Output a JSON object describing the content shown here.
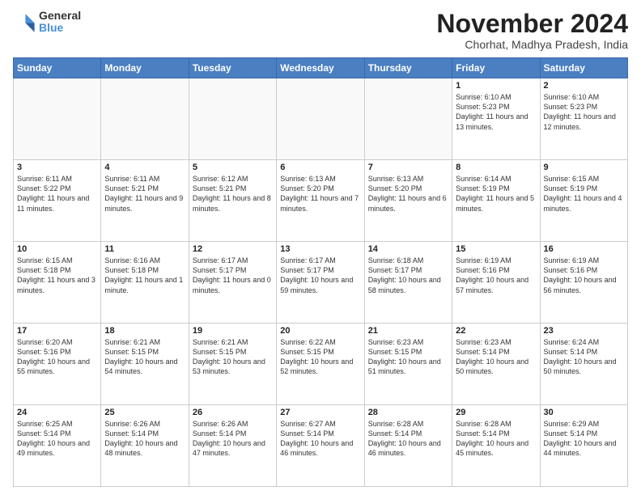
{
  "logo": {
    "general": "General",
    "blue": "Blue"
  },
  "header": {
    "month": "November 2024",
    "location": "Chorhat, Madhya Pradesh, India"
  },
  "weekdays": [
    "Sunday",
    "Monday",
    "Tuesday",
    "Wednesday",
    "Thursday",
    "Friday",
    "Saturday"
  ],
  "weeks": [
    [
      {
        "day": "",
        "info": ""
      },
      {
        "day": "",
        "info": ""
      },
      {
        "day": "",
        "info": ""
      },
      {
        "day": "",
        "info": ""
      },
      {
        "day": "",
        "info": ""
      },
      {
        "day": "1",
        "info": "Sunrise: 6:10 AM\nSunset: 5:23 PM\nDaylight: 11 hours and 13 minutes."
      },
      {
        "day": "2",
        "info": "Sunrise: 6:10 AM\nSunset: 5:23 PM\nDaylight: 11 hours and 12 minutes."
      }
    ],
    [
      {
        "day": "3",
        "info": "Sunrise: 6:11 AM\nSunset: 5:22 PM\nDaylight: 11 hours and 11 minutes."
      },
      {
        "day": "4",
        "info": "Sunrise: 6:11 AM\nSunset: 5:21 PM\nDaylight: 11 hours and 9 minutes."
      },
      {
        "day": "5",
        "info": "Sunrise: 6:12 AM\nSunset: 5:21 PM\nDaylight: 11 hours and 8 minutes."
      },
      {
        "day": "6",
        "info": "Sunrise: 6:13 AM\nSunset: 5:20 PM\nDaylight: 11 hours and 7 minutes."
      },
      {
        "day": "7",
        "info": "Sunrise: 6:13 AM\nSunset: 5:20 PM\nDaylight: 11 hours and 6 minutes."
      },
      {
        "day": "8",
        "info": "Sunrise: 6:14 AM\nSunset: 5:19 PM\nDaylight: 11 hours and 5 minutes."
      },
      {
        "day": "9",
        "info": "Sunrise: 6:15 AM\nSunset: 5:19 PM\nDaylight: 11 hours and 4 minutes."
      }
    ],
    [
      {
        "day": "10",
        "info": "Sunrise: 6:15 AM\nSunset: 5:18 PM\nDaylight: 11 hours and 3 minutes."
      },
      {
        "day": "11",
        "info": "Sunrise: 6:16 AM\nSunset: 5:18 PM\nDaylight: 11 hours and 1 minute."
      },
      {
        "day": "12",
        "info": "Sunrise: 6:17 AM\nSunset: 5:17 PM\nDaylight: 11 hours and 0 minutes."
      },
      {
        "day": "13",
        "info": "Sunrise: 6:17 AM\nSunset: 5:17 PM\nDaylight: 10 hours and 59 minutes."
      },
      {
        "day": "14",
        "info": "Sunrise: 6:18 AM\nSunset: 5:17 PM\nDaylight: 10 hours and 58 minutes."
      },
      {
        "day": "15",
        "info": "Sunrise: 6:19 AM\nSunset: 5:16 PM\nDaylight: 10 hours and 57 minutes."
      },
      {
        "day": "16",
        "info": "Sunrise: 6:19 AM\nSunset: 5:16 PM\nDaylight: 10 hours and 56 minutes."
      }
    ],
    [
      {
        "day": "17",
        "info": "Sunrise: 6:20 AM\nSunset: 5:16 PM\nDaylight: 10 hours and 55 minutes."
      },
      {
        "day": "18",
        "info": "Sunrise: 6:21 AM\nSunset: 5:15 PM\nDaylight: 10 hours and 54 minutes."
      },
      {
        "day": "19",
        "info": "Sunrise: 6:21 AM\nSunset: 5:15 PM\nDaylight: 10 hours and 53 minutes."
      },
      {
        "day": "20",
        "info": "Sunrise: 6:22 AM\nSunset: 5:15 PM\nDaylight: 10 hours and 52 minutes."
      },
      {
        "day": "21",
        "info": "Sunrise: 6:23 AM\nSunset: 5:15 PM\nDaylight: 10 hours and 51 minutes."
      },
      {
        "day": "22",
        "info": "Sunrise: 6:23 AM\nSunset: 5:14 PM\nDaylight: 10 hours and 50 minutes."
      },
      {
        "day": "23",
        "info": "Sunrise: 6:24 AM\nSunset: 5:14 PM\nDaylight: 10 hours and 50 minutes."
      }
    ],
    [
      {
        "day": "24",
        "info": "Sunrise: 6:25 AM\nSunset: 5:14 PM\nDaylight: 10 hours and 49 minutes."
      },
      {
        "day": "25",
        "info": "Sunrise: 6:26 AM\nSunset: 5:14 PM\nDaylight: 10 hours and 48 minutes."
      },
      {
        "day": "26",
        "info": "Sunrise: 6:26 AM\nSunset: 5:14 PM\nDaylight: 10 hours and 47 minutes."
      },
      {
        "day": "27",
        "info": "Sunrise: 6:27 AM\nSunset: 5:14 PM\nDaylight: 10 hours and 46 minutes."
      },
      {
        "day": "28",
        "info": "Sunrise: 6:28 AM\nSunset: 5:14 PM\nDaylight: 10 hours and 46 minutes."
      },
      {
        "day": "29",
        "info": "Sunrise: 6:28 AM\nSunset: 5:14 PM\nDaylight: 10 hours and 45 minutes."
      },
      {
        "day": "30",
        "info": "Sunrise: 6:29 AM\nSunset: 5:14 PM\nDaylight: 10 hours and 44 minutes."
      }
    ]
  ]
}
